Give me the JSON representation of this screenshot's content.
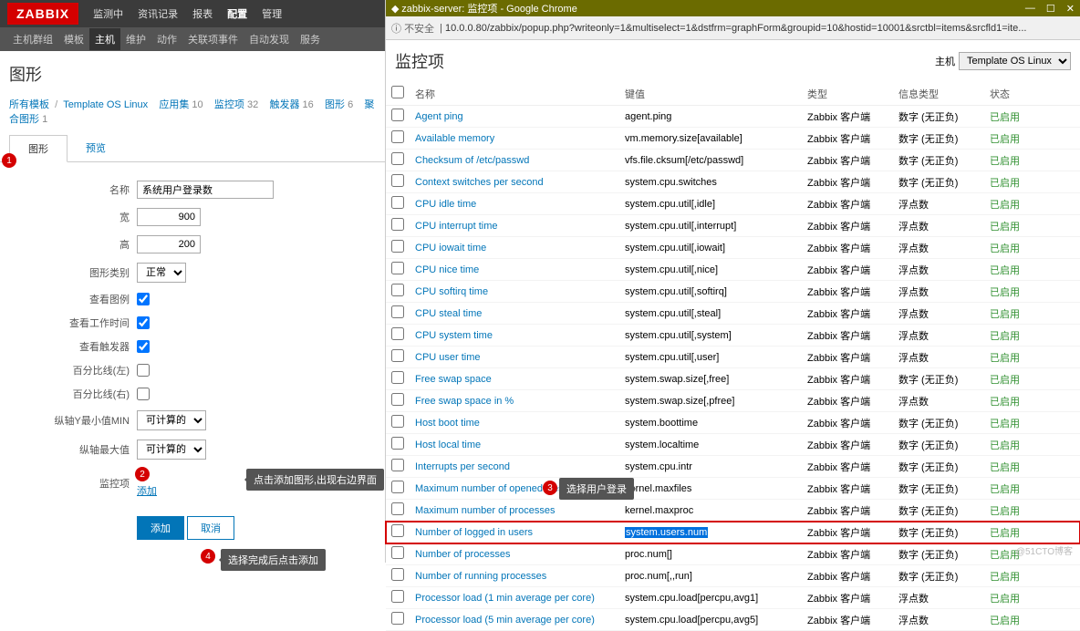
{
  "logo": "ZABBIX",
  "topmenu": {
    "m0": "监测中",
    "m1": "资讯记录",
    "m2": "报表",
    "m3": "配置",
    "m4": "管理"
  },
  "submenu": {
    "s0": "主机群组",
    "s1": "模板",
    "s2": "主机",
    "s3": "维护",
    "s4": "动作",
    "s5": "关联项事件",
    "s6": "自动发现",
    "s7": "服务"
  },
  "page_title": "图形",
  "breadcrumb": {
    "b0": "所有模板",
    "b1": "Template OS Linux",
    "b2": "应用集",
    "c2": "10",
    "b3": "监控项",
    "c3": "32",
    "b4": "触发器",
    "c4": "16",
    "b5": "图形",
    "c5": "6",
    "b6": "聚合图形",
    "c6": "1"
  },
  "tabs": {
    "t0": "图形",
    "t1": "预览"
  },
  "form": {
    "l_name": "名称",
    "v_name": "系统用户登录数",
    "l_width": "宽",
    "v_width": "900",
    "l_height": "高",
    "v_height": "200",
    "l_type": "图形类别",
    "v_type": "正常",
    "l_legend": "查看图例",
    "l_worktime": "查看工作时间",
    "l_trigger": "查看触发器",
    "l_pleft": "百分比线(左)",
    "l_pright": "百分比线(右)",
    "l_ymin": "纵轴Y最小值MIN",
    "v_ymin": "可计算的",
    "l_ymax": "纵轴最大值",
    "v_ymax": "可计算的",
    "l_items": "监控项",
    "add_link": "添加",
    "btn_add": "添加",
    "btn_cancel": "取消"
  },
  "badges": {
    "b1": "1",
    "b2": "2",
    "b3": "3",
    "b4": "4"
  },
  "tips": {
    "t2": "点击添加图形,出现右边界面",
    "t3": "选择用户登录",
    "t4": "选择完成后点击添加"
  },
  "chrome": {
    "title": "zabbix-server: 监控项 - Google Chrome",
    "unsafe": "不安全",
    "sep": "|",
    "url": "10.0.0.80/zabbix/popup.php?writeonly=1&multiselect=1&dstfrm=graphForm&groupid=10&hostid=10001&srctbl=items&srcfld1=ite..."
  },
  "popup": {
    "title": "监控项",
    "host_label": "主机",
    "host_value": "Template OS Linux",
    "th_name": "名称",
    "th_key": "键值",
    "th_type": "类型",
    "th_info": "信息类型",
    "th_status": "状态"
  },
  "items": [
    {
      "name": "Agent ping",
      "key": "agent.ping",
      "type": "Zabbix 客户端",
      "info": "数字 (无正负)",
      "status": "已启用"
    },
    {
      "name": "Available memory",
      "key": "vm.memory.size[available]",
      "type": "Zabbix 客户端",
      "info": "数字 (无正负)",
      "status": "已启用"
    },
    {
      "name": "Checksum of /etc/passwd",
      "key": "vfs.file.cksum[/etc/passwd]",
      "type": "Zabbix 客户端",
      "info": "数字 (无正负)",
      "status": "已启用"
    },
    {
      "name": "Context switches per second",
      "key": "system.cpu.switches",
      "type": "Zabbix 客户端",
      "info": "数字 (无正负)",
      "status": "已启用"
    },
    {
      "name": "CPU idle time",
      "key": "system.cpu.util[,idle]",
      "type": "Zabbix 客户端",
      "info": "浮点数",
      "status": "已启用"
    },
    {
      "name": "CPU interrupt time",
      "key": "system.cpu.util[,interrupt]",
      "type": "Zabbix 客户端",
      "info": "浮点数",
      "status": "已启用"
    },
    {
      "name": "CPU iowait time",
      "key": "system.cpu.util[,iowait]",
      "type": "Zabbix 客户端",
      "info": "浮点数",
      "status": "已启用"
    },
    {
      "name": "CPU nice time",
      "key": "system.cpu.util[,nice]",
      "type": "Zabbix 客户端",
      "info": "浮点数",
      "status": "已启用"
    },
    {
      "name": "CPU softirq time",
      "key": "system.cpu.util[,softirq]",
      "type": "Zabbix 客户端",
      "info": "浮点数",
      "status": "已启用"
    },
    {
      "name": "CPU steal time",
      "key": "system.cpu.util[,steal]",
      "type": "Zabbix 客户端",
      "info": "浮点数",
      "status": "已启用"
    },
    {
      "name": "CPU system time",
      "key": "system.cpu.util[,system]",
      "type": "Zabbix 客户端",
      "info": "浮点数",
      "status": "已启用"
    },
    {
      "name": "CPU user time",
      "key": "system.cpu.util[,user]",
      "type": "Zabbix 客户端",
      "info": "浮点数",
      "status": "已启用"
    },
    {
      "name": "Free swap space",
      "key": "system.swap.size[,free]",
      "type": "Zabbix 客户端",
      "info": "数字 (无正负)",
      "status": "已启用"
    },
    {
      "name": "Free swap space in %",
      "key": "system.swap.size[,pfree]",
      "type": "Zabbix 客户端",
      "info": "浮点数",
      "status": "已启用"
    },
    {
      "name": "Host boot time",
      "key": "system.boottime",
      "type": "Zabbix 客户端",
      "info": "数字 (无正负)",
      "status": "已启用"
    },
    {
      "name": "Host local time",
      "key": "system.localtime",
      "type": "Zabbix 客户端",
      "info": "数字 (无正负)",
      "status": "已启用"
    },
    {
      "name": "Interrupts per second",
      "key": "system.cpu.intr",
      "type": "Zabbix 客户端",
      "info": "数字 (无正负)",
      "status": "已启用"
    },
    {
      "name": "Maximum number of opened files",
      "key": "kernel.maxfiles",
      "type": "Zabbix 客户端",
      "info": "数字 (无正负)",
      "status": "已启用"
    },
    {
      "name": "Maximum number of processes",
      "key": "kernel.maxproc",
      "type": "Zabbix 客户端",
      "info": "数字 (无正负)",
      "status": "已启用"
    },
    {
      "name": "Number of logged in users",
      "key": "system.users.num",
      "type": "Zabbix 客户端",
      "info": "数字 (无正负)",
      "status": "已启用",
      "highlight": true,
      "selkey": true
    },
    {
      "name": "Number of processes",
      "key": "proc.num[]",
      "type": "Zabbix 客户端",
      "info": "数字 (无正负)",
      "status": "已启用"
    },
    {
      "name": "Number of running processes",
      "key": "proc.num[,,run]",
      "type": "Zabbix 客户端",
      "info": "数字 (无正负)",
      "status": "已启用"
    },
    {
      "name": "Processor load (1 min average per core)",
      "key": "system.cpu.load[percpu,avg1]",
      "type": "Zabbix 客户端",
      "info": "浮点数",
      "status": "已启用"
    },
    {
      "name": "Processor load (5 min average per core)",
      "key": "system.cpu.load[percpu,avg5]",
      "type": "Zabbix 客户端",
      "info": "浮点数",
      "status": "已启用"
    }
  ],
  "watermark": "@51CTO博客"
}
